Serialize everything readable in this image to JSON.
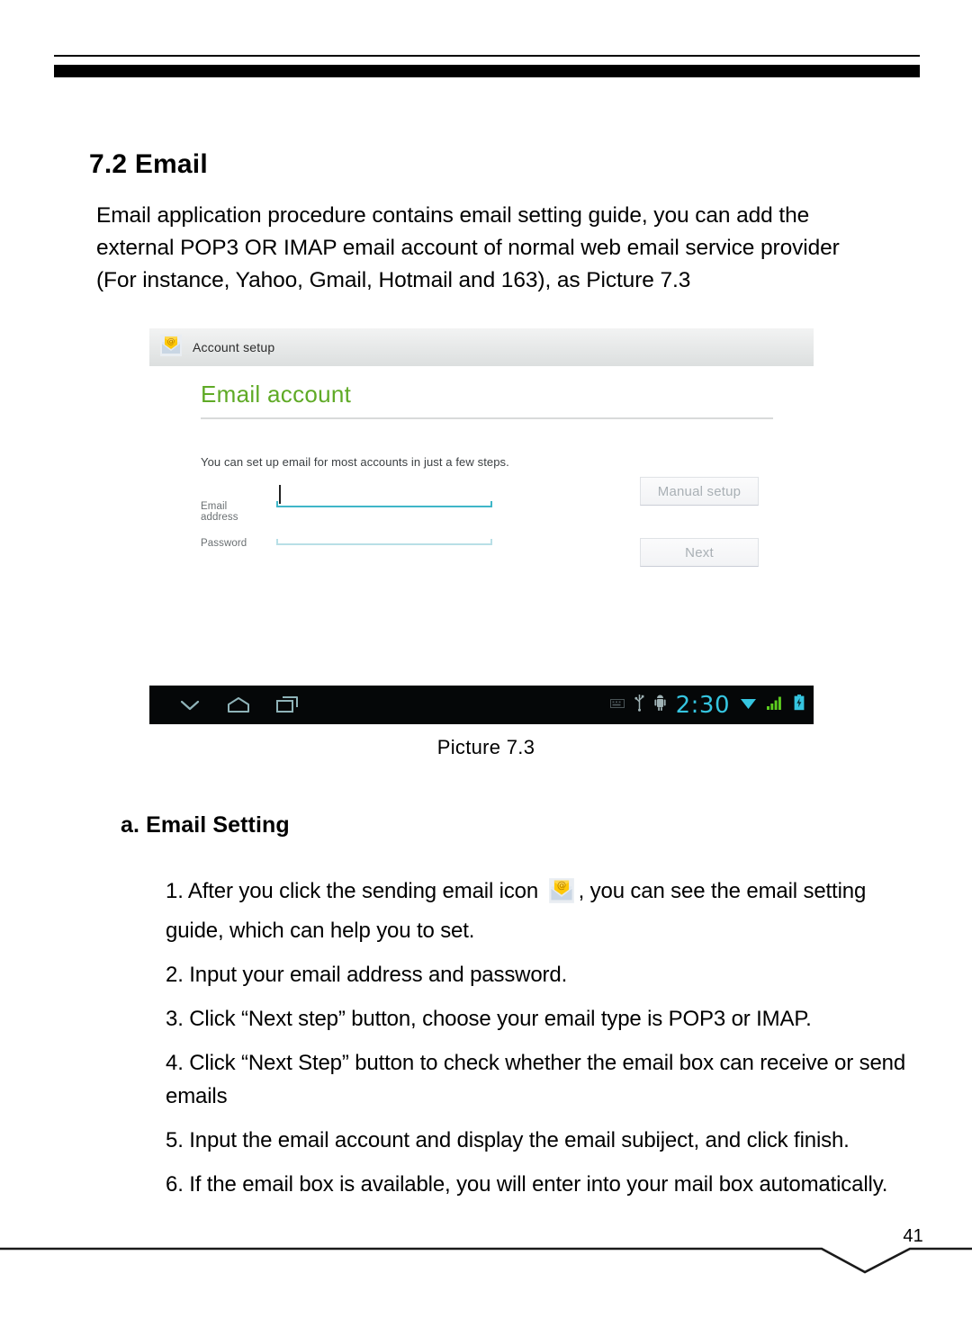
{
  "document": {
    "section_number": "7.2",
    "section_title": "7.2 Email",
    "intro_paragraph": "Email application procedure contains email setting guide, you can add the external POP3 OR IMAP email account of normal web email service provider (For instance, Yahoo, Gmail, Hotmail and 163), as Picture 7.3",
    "figure_caption": "Picture 7.3",
    "subsection_title": "a. Email Setting",
    "page_number": "41"
  },
  "steps": [
    {
      "text_before": "1. After you click the sending email icon",
      "icon": "email-app-icon",
      "text_after": ", you can see the email setting guide, which can help you to set."
    },
    {
      "text_before": "2. Input your email address and password.",
      "icon": null,
      "text_after": ""
    },
    {
      "text_before": "3. Click “Next step” button, choose your email type is POP3 or IMAP.",
      "icon": null,
      "text_after": ""
    },
    {
      "text_before": "4. Click “Next Step” button to check whether the email box can receive or send emails",
      "icon": null,
      "text_after": ""
    },
    {
      "text_before": "5. Input the email account and display the email subiject, and click finish.",
      "icon": null,
      "text_after": ""
    },
    {
      "text_before": "6. If the email box is available, you will enter into your mail box automatically.",
      "icon": null,
      "text_after": ""
    }
  ],
  "screenshot": {
    "titlebar": {
      "icon": "email-app-icon",
      "title": "Account setup"
    },
    "heading": "Email account",
    "heading_color": "#5faa26",
    "description": "You can set up email for most accounts in just a few steps.",
    "fields": [
      {
        "label": "Email address",
        "value": "",
        "placeholder": "",
        "focused": true
      },
      {
        "label": "Password",
        "value": "",
        "placeholder": "",
        "focused": false
      }
    ],
    "buttons": [
      {
        "label": "Manual setup",
        "name": "manual-setup-button"
      },
      {
        "label": "Next",
        "name": "next-button"
      }
    ],
    "navbar": {
      "buttons": [
        "back-icon",
        "home-icon",
        "recents-icon"
      ],
      "status_icons": [
        "keyboard-icon",
        "usb-icon",
        "android-robot-icon"
      ],
      "clock": "2:30",
      "right_icons": [
        "wifi-icon",
        "signal-icon",
        "battery-icon"
      ],
      "clock_color": "#35c5e0",
      "signal_color": "#5ccc1f",
      "battery_color": "#35c5e0"
    }
  }
}
